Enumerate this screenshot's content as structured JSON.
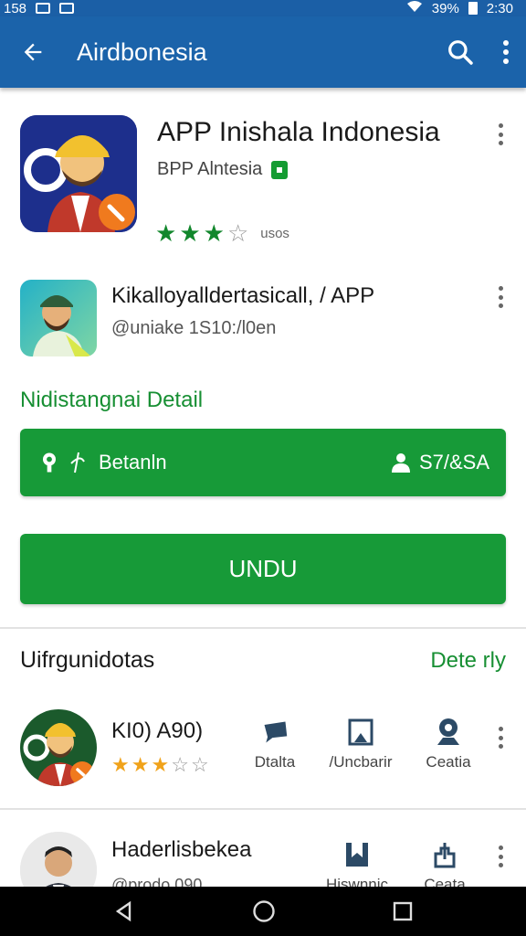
{
  "status_bar": {
    "time": "2:30",
    "battery": "39%",
    "left_text": "158"
  },
  "app_bar": {
    "title": "Airdbonesia",
    "back_icon": "arrow-back-icon",
    "search_icon": "search-icon",
    "more_icon": "more-vert-icon"
  },
  "hero": {
    "title": "APP Inishala Indonesia",
    "developer": "BPP Alntesia",
    "rating": 3,
    "rating_max": 4,
    "rating_count": "usos"
  },
  "developer_card": {
    "name": "Kikalloyalldertasicall, / APP",
    "handle": "@uniake 1S10:/l0en"
  },
  "detail_section": {
    "title": "Nidistangnai Detail",
    "bar_label": "Betanln",
    "bar_right": "S7/&SA"
  },
  "install_button": {
    "label": "UNDU"
  },
  "list_section": {
    "title": "Uifrgunidotas",
    "more_label": "Dete rly"
  },
  "list_items": [
    {
      "title": "KI0) A90)",
      "rating": 2.5,
      "actions": [
        {
          "label": "Dtalta",
          "icon": "chat-icon"
        },
        {
          "label": "/Uncbarir",
          "icon": "bookmark-icon"
        },
        {
          "label": "Ceatia",
          "icon": "location-icon"
        }
      ]
    },
    {
      "title": "Haderlisbekea",
      "subtitle": "@prodo 090",
      "actions": [
        {
          "label": "Hiswnnic",
          "icon": "bookmark-icon"
        },
        {
          "label": "Ceata",
          "icon": "share-icon"
        }
      ]
    }
  ],
  "colors": {
    "primary": "#1b63aa",
    "green": "#179a38",
    "star_orange": "#f0a21a"
  }
}
